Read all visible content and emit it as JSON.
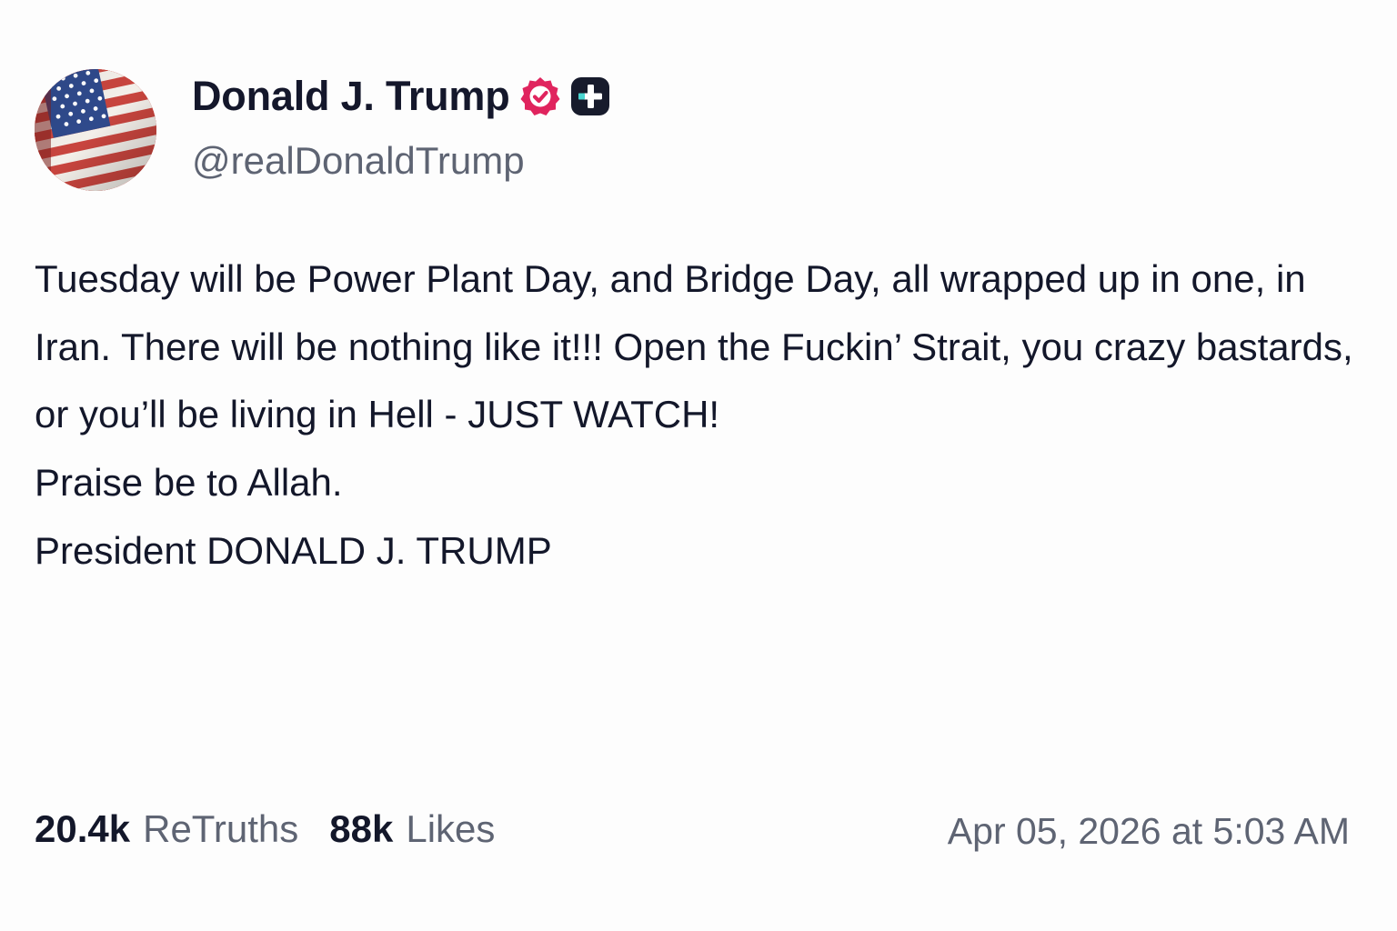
{
  "author": {
    "display_name": "Donald J. Trump",
    "handle": "@realDonaldTrump",
    "avatar_icon": "american-flag-avatar",
    "verified_icon": "verified-badge-icon",
    "verified_color": "#e0245e",
    "plus_icon": "truth-plus-badge-icon"
  },
  "post": {
    "lines": [
      "Tuesday will be Power Plant Day, and Bridge Day, all wrapped up in one, in Iran. There will be nothing like it!!! Open the Fuckin’ Strait, you crazy bastards, or you’ll be living in Hell - JUST WATCH!",
      "Praise be to Allah."
    ],
    "signature": "President DONALD J. TRUMP"
  },
  "stats": {
    "retruths_count": "20.4k",
    "retruths_label": "ReTruths",
    "likes_count": "88k",
    "likes_label": "Likes"
  },
  "timestamp": "Apr 05, 2026 at 5:03 AM"
}
